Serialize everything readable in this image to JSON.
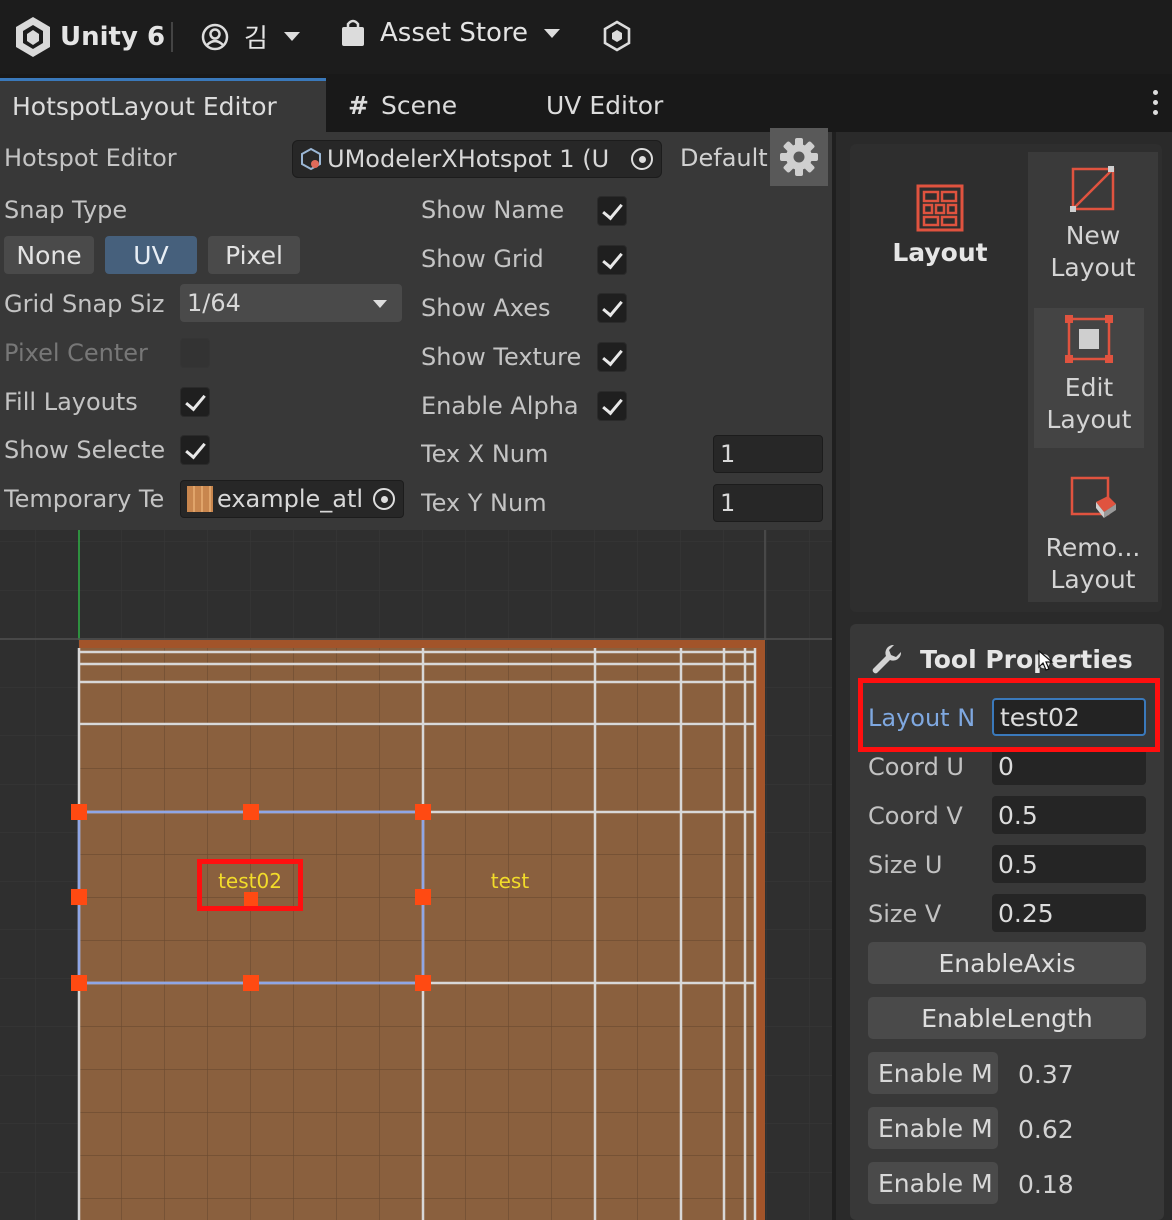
{
  "topbar": {
    "app": "Unity 6",
    "account": "김",
    "asset_store": "Asset Store"
  },
  "tabs": [
    {
      "label": "HotspotLayout Editor",
      "active": true
    },
    {
      "label": "Scene",
      "active": false
    },
    {
      "label": "UV Editor",
      "active": false
    }
  ],
  "editor": {
    "title": "Hotspot Editor",
    "hotspot_asset": "UModelerXHotspot 1 (U",
    "default_label": "Default",
    "right_edge_value": "1",
    "snap_type_label": "Snap Type",
    "snap_options": [
      "None",
      "UV",
      "Pixel"
    ],
    "snap_selected": "UV",
    "grid_snap_label": "Grid Snap Siz",
    "grid_snap_value": "1/64",
    "pixel_center_label": "Pixel Center",
    "pixel_center_checked": false,
    "fill_layouts_label": "Fill Layouts",
    "fill_layouts_checked": true,
    "show_selected_label": "Show Selecte",
    "show_selected_checked": true,
    "temp_texture_label": "Temporary Te",
    "temp_texture_value": "example_atl",
    "show_name_label": "Show Name",
    "show_grid_label": "Show Grid",
    "show_axes_label": "Show Axes",
    "show_texture_label": "Show Texture",
    "enable_alpha_label": "Enable Alpha",
    "tex_x_label": "Tex X Num",
    "tex_x_value": "1",
    "tex_y_label": "Tex Y Num",
    "tex_y_value": "1"
  },
  "canvas": {
    "layouts": [
      {
        "name": "test02",
        "selected": true
      },
      {
        "name": "test",
        "selected": false
      }
    ]
  },
  "tools": {
    "layout": "Layout",
    "new_layout": [
      "New",
      "Layout"
    ],
    "edit_layout": [
      "Edit",
      "Layout"
    ],
    "remove_layout": [
      "Remo...",
      "Layout"
    ]
  },
  "tool_properties": {
    "title": "Tool Properties",
    "layout_name_label": "Layout N",
    "layout_name_value": "test02",
    "coord_u_label": "Coord U",
    "coord_u_value": "0",
    "coord_v_label": "Coord V",
    "coord_v_value": "0.5",
    "size_u_label": "Size U",
    "size_u_value": "0.5",
    "size_v_label": "Size V",
    "size_v_value": "0.25",
    "enable_axis": "EnableAxis",
    "enable_length": "EnableLength",
    "enable_rows": [
      {
        "label": "Enable M",
        "value": "0.37"
      },
      {
        "label": "Enable M",
        "value": "0.62"
      },
      {
        "label": "Enable M",
        "value": "0.18"
      }
    ]
  },
  "colors": {
    "highlight_red": "#ff0f0f",
    "selected_blue": "#46607c",
    "handle_orange": "#ff4a12",
    "label_yellow": "#f2dc2a"
  }
}
